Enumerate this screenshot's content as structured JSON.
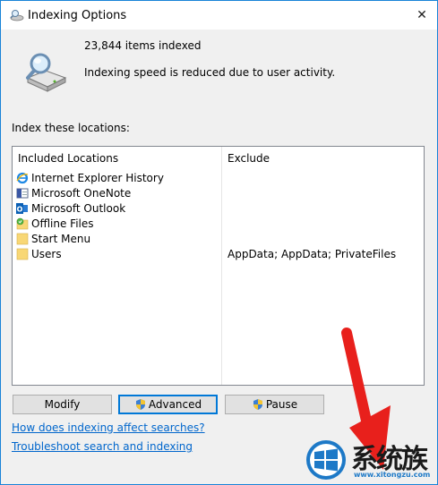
{
  "window": {
    "title": "Indexing Options",
    "close_label": "✕"
  },
  "status": {
    "items_indexed": "23,844 items indexed",
    "message": "Indexing speed is reduced due to user activity."
  },
  "locations": {
    "section_label": "Index these locations:",
    "columns": {
      "included": "Included Locations",
      "exclude": "Exclude"
    },
    "rows": [
      {
        "name": "Internet Explorer History",
        "icon": "ie-icon",
        "exclude": ""
      },
      {
        "name": "Microsoft OneNote",
        "icon": "onenote-icon",
        "exclude": ""
      },
      {
        "name": "Microsoft Outlook",
        "icon": "outlook-icon",
        "exclude": ""
      },
      {
        "name": "Offline Files",
        "icon": "offline-files-icon",
        "exclude": ""
      },
      {
        "name": "Start Menu",
        "icon": "folder-icon",
        "exclude": ""
      },
      {
        "name": "Users",
        "icon": "folder-icon",
        "exclude": "AppData; AppData; PrivateFiles"
      }
    ]
  },
  "buttons": {
    "modify": "Modify",
    "advanced": "Advanced",
    "pause": "Pause"
  },
  "links": {
    "how_does": "How does indexing affect searches?",
    "troubleshoot": "Troubleshoot search and indexing"
  },
  "watermark": {
    "text": "系统族",
    "url": "www.xitongzu.com"
  },
  "colors": {
    "accent": "#0078d7",
    "link": "#0066cc",
    "arrow": "#e8201c",
    "folder": "#f8d775"
  }
}
